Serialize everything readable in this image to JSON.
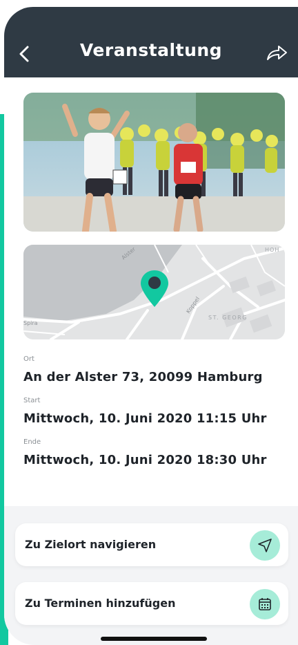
{
  "header": {
    "title": "Veranstaltung",
    "back_icon": "chevron-left-icon",
    "share_icon": "share-forward-icon"
  },
  "map": {
    "labels": [
      "Alster",
      "Koppel",
      "ST. GEORG",
      "HOH",
      "Spira"
    ],
    "marker_icon": "map-pin-icon"
  },
  "details": {
    "location_label": "Ort",
    "location_value": "An der Alster 73, 20099 Hamburg",
    "start_label": "Start",
    "start_value": "Mittwoch, 10. Juni 2020 11:15 Uhr",
    "end_label": "Ende",
    "end_value": "Mittwoch, 10. Juni 2020 18:30 Uhr"
  },
  "actions": {
    "navigate_label": "Zu Zielort navigieren",
    "navigate_icon": "navigation-arrow-icon",
    "calendar_label": "Zu Terminen hinzufügen",
    "calendar_icon": "calendar-icon"
  },
  "colors": {
    "header_bg": "#2f3a44",
    "accent": "#12c8a0",
    "icon_circle": "#a6ecd8",
    "marker": "#12c8a0"
  }
}
